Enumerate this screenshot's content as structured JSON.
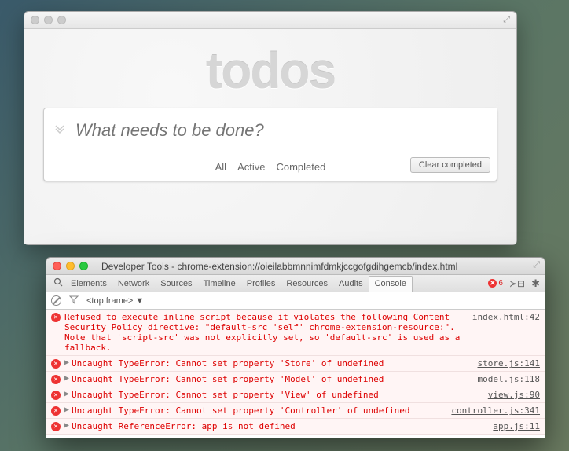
{
  "app": {
    "title": "todos",
    "input_placeholder": "What needs to be done?",
    "filters": {
      "all": "All",
      "active": "Active",
      "completed": "Completed"
    },
    "clear_label": "Clear completed"
  },
  "devtools": {
    "window_title": "Developer Tools - chrome-extension://oieilabbmnnimfdmkjccgofgdihgemcb/index.html",
    "tabs": {
      "elements": "Elements",
      "network": "Network",
      "sources": "Sources",
      "timeline": "Timeline",
      "profiles": "Profiles",
      "resources": "Resources",
      "audits": "Audits",
      "console": "Console"
    },
    "error_count": "6",
    "frame_label": "<top frame>",
    "errors": [
      {
        "message": "Refused to execute inline script because it violates the following Content Security Policy directive: \"default-src 'self' chrome-extension-resource:\". Note that 'script-src' was not explicitly set, so 'default-src' is used as a fallback.",
        "source": "index.html:42",
        "expandable": false
      },
      {
        "message": "Uncaught TypeError: Cannot set property 'Store' of undefined",
        "source": "store.js:141",
        "expandable": true
      },
      {
        "message": "Uncaught TypeError: Cannot set property 'Model' of undefined",
        "source": "model.js:118",
        "expandable": true
      },
      {
        "message": "Uncaught TypeError: Cannot set property 'View' of undefined",
        "source": "view.js:90",
        "expandable": true
      },
      {
        "message": "Uncaught TypeError: Cannot set property 'Controller' of undefined",
        "source": "controller.js:341",
        "expandable": true
      },
      {
        "message": "Uncaught ReferenceError: app is not defined",
        "source": "app.js:11",
        "expandable": true
      }
    ]
  }
}
